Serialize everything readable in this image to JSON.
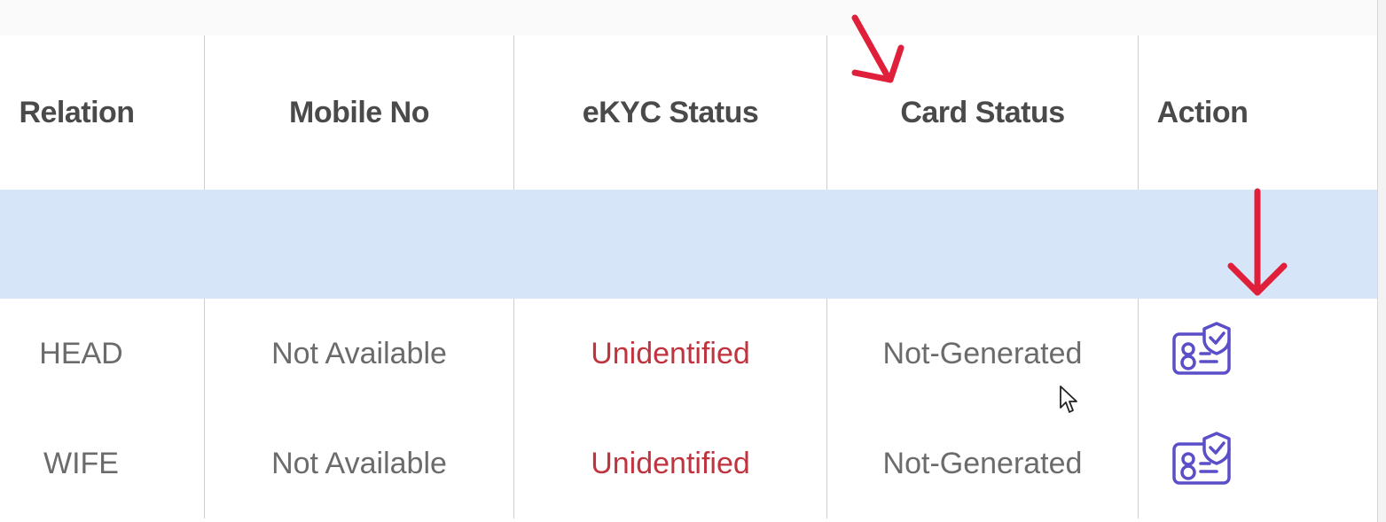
{
  "table": {
    "headers": [
      "Relation",
      "Mobile No",
      "eKYC Status",
      "Card Status",
      "Action"
    ],
    "rows": [
      {
        "relation": "HEAD",
        "mobile": "Not Available",
        "ekyc": "Unidentified",
        "card": "Not-Generated",
        "action_icon": "id-card-shield-icon"
      },
      {
        "relation": "WIFE",
        "mobile": "Not Available",
        "ekyc": "Unidentified",
        "card": "Not-Generated",
        "action_icon": "id-card-shield-icon"
      }
    ]
  },
  "colors": {
    "header_text": "#4a4a4a",
    "body_text": "#6b6b6b",
    "status_unidentified": "#c0343f",
    "group_row_bg": "#d6e6f8",
    "icon_purple": "#5b4ec9",
    "annotation_red": "#e0203a"
  },
  "annotations": [
    "red-arrow-card-status",
    "red-arrow-action"
  ]
}
